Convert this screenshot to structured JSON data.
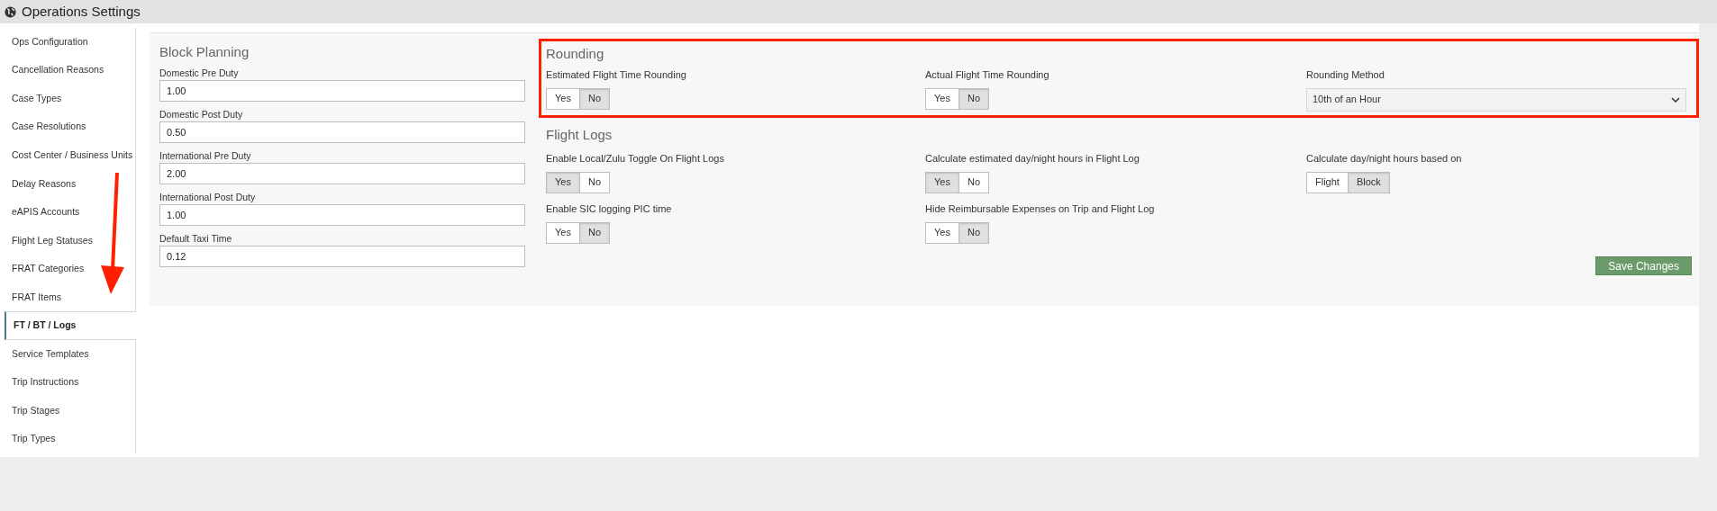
{
  "header": {
    "title": "Operations Settings"
  },
  "sidebar": {
    "items": [
      {
        "label": "Ops Configuration",
        "selected": false
      },
      {
        "label": "Cancellation Reasons",
        "selected": false
      },
      {
        "label": "Case Types",
        "selected": false
      },
      {
        "label": "Case Resolutions",
        "selected": false
      },
      {
        "label": "Cost Center / Business Units",
        "selected": false
      },
      {
        "label": "Delay Reasons",
        "selected": false
      },
      {
        "label": "eAPIS Accounts",
        "selected": false
      },
      {
        "label": "Flight Leg Statuses",
        "selected": false
      },
      {
        "label": "FRAT Categories",
        "selected": false
      },
      {
        "label": "FRAT Items",
        "selected": false
      },
      {
        "label": "FT / BT / Logs",
        "selected": true
      },
      {
        "label": "Service Templates",
        "selected": false
      },
      {
        "label": "Trip Instructions",
        "selected": false
      },
      {
        "label": "Trip Stages",
        "selected": false
      },
      {
        "label": "Trip Types",
        "selected": false
      }
    ]
  },
  "block_planning": {
    "title": "Block Planning",
    "fields": [
      {
        "label": "Domestic Pre Duty",
        "value": "1.00"
      },
      {
        "label": "Domestic Post Duty",
        "value": "0.50"
      },
      {
        "label": "International Pre Duty",
        "value": "2.00"
      },
      {
        "label": "International Post Duty",
        "value": "1.00"
      },
      {
        "label": "Default Taxi Time",
        "value": "0.12"
      }
    ]
  },
  "rounding": {
    "title": "Rounding",
    "settings": [
      {
        "kind": "toggle",
        "label": "Estimated Flight Time Rounding",
        "options": [
          {
            "label": "Yes",
            "selected": false
          },
          {
            "label": "No",
            "selected": true
          }
        ]
      },
      {
        "kind": "toggle",
        "label": "Actual Flight Time Rounding",
        "options": [
          {
            "label": "Yes",
            "selected": false
          },
          {
            "label": "No",
            "selected": true
          }
        ]
      },
      {
        "kind": "select",
        "label": "Rounding Method",
        "value": "10th of an Hour"
      }
    ]
  },
  "flight_logs": {
    "title": "Flight Logs",
    "settings": [
      {
        "kind": "toggle",
        "label": "Enable Local/Zulu Toggle On Flight Logs",
        "options": [
          {
            "label": "Yes",
            "selected": true
          },
          {
            "label": "No",
            "selected": false
          }
        ]
      },
      {
        "kind": "toggle",
        "label": "Calculate estimated day/night hours in Flight Log",
        "options": [
          {
            "label": "Yes",
            "selected": true
          },
          {
            "label": "No",
            "selected": false
          }
        ]
      },
      {
        "kind": "toggle",
        "label": "Calculate day/night hours based on",
        "options": [
          {
            "label": "Flight",
            "selected": false
          },
          {
            "label": "Block",
            "selected": true
          }
        ]
      },
      {
        "kind": "toggle",
        "label": "Enable SIC logging PIC time",
        "options": [
          {
            "label": "Yes",
            "selected": false
          },
          {
            "label": "No",
            "selected": true
          }
        ]
      },
      {
        "kind": "toggle",
        "label": "Hide Reimbursable Expenses on Trip and Flight Log",
        "options": [
          {
            "label": "Yes",
            "selected": false
          },
          {
            "label": "No",
            "selected": true
          }
        ]
      }
    ]
  },
  "save_button": {
    "label": "Save Changes"
  }
}
